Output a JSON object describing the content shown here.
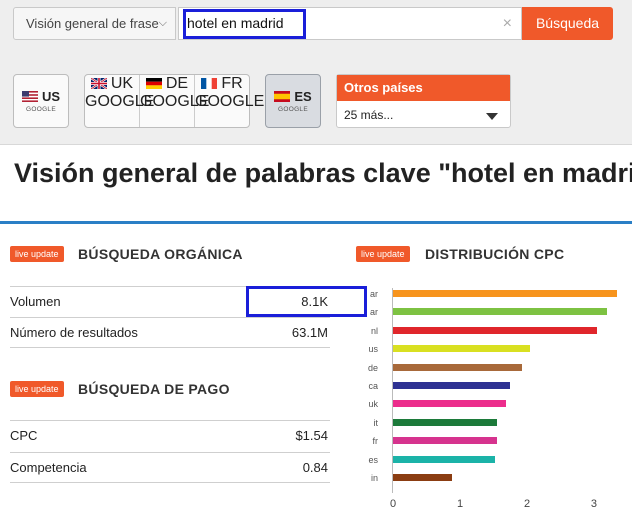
{
  "search": {
    "database_label": "Visión general de frase",
    "query": "hotel en madrid",
    "clear_symbol": "×",
    "button_label": "Búsqueda"
  },
  "databases": [
    {
      "code": "US",
      "sub": "GOOGLE"
    },
    {
      "code": "UK",
      "sub": "GOOGLE"
    },
    {
      "code": "DE",
      "sub": "GOOGLE"
    },
    {
      "code": "FR",
      "sub": "GOOGLE"
    },
    {
      "code": "ES",
      "sub": "GOOGLE",
      "active": true
    }
  ],
  "other_countries": {
    "title": "Otros países",
    "selected": "25 más..."
  },
  "page_title": "Visión general de palabras clave \"hotel en madrid\"",
  "live_label": "live update",
  "organic": {
    "title": "BÚSQUEDA ORGÁNICA",
    "rows": [
      {
        "label": "Volumen",
        "value": "8.1K"
      },
      {
        "label": "Número de resultados",
        "value": "63.1M"
      }
    ]
  },
  "paid": {
    "title": "BÚSQUEDA DE PAGO",
    "rows": [
      {
        "label": "CPC",
        "value": "$1.54"
      },
      {
        "label": "Competencia",
        "value": "0.84"
      }
    ]
  },
  "cpc_distribution": {
    "title": "DISTRIBUCIÓN CPC"
  },
  "chart_data": {
    "type": "bar",
    "orientation": "horizontal",
    "title": "DISTRIBUCIÓN CPC",
    "categories": [
      "ar",
      "ar",
      "nl",
      "us",
      "de",
      "ca",
      "uk",
      "it",
      "fr",
      "es",
      "in"
    ],
    "values": [
      3.35,
      3.2,
      3.05,
      2.05,
      1.92,
      1.75,
      1.68,
      1.55,
      1.55,
      1.52,
      0.88
    ],
    "colors": [
      "#f7941d",
      "#7dc242",
      "#e0262b",
      "#d9e021",
      "#a8693a",
      "#2e3192",
      "#ec2d8c",
      "#1c7a3a",
      "#d6338e",
      "#1bb3a8",
      "#8b3d12"
    ],
    "xticks": [
      "0",
      "1",
      "2",
      "3"
    ],
    "xlim": [
      0,
      3.4
    ]
  }
}
